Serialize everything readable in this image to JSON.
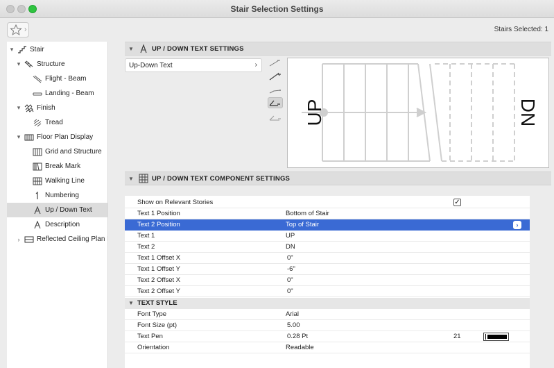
{
  "window": {
    "title": "Stair Selection Settings"
  },
  "toolbar": {
    "stairs_selected": "Stairs Selected: 1"
  },
  "tree": [
    {
      "label": "Stair",
      "icon": "stair-icon",
      "disclosure": "▾"
    },
    {
      "label": "Structure",
      "icon": "structure-icon",
      "disclosure": "▾"
    },
    {
      "label": "Flight - Beam",
      "icon": "flight-beam-icon",
      "disclosure": ""
    },
    {
      "label": "Landing - Beam",
      "icon": "landing-beam-icon",
      "disclosure": ""
    },
    {
      "label": "Finish",
      "icon": "finish-icon",
      "disclosure": "▾"
    },
    {
      "label": "Tread",
      "icon": "tread-icon",
      "disclosure": ""
    },
    {
      "label": "Floor Plan Display",
      "icon": "floor-plan-icon",
      "disclosure": "▾"
    },
    {
      "label": "Grid and Structure",
      "icon": "grid-icon",
      "disclosure": ""
    },
    {
      "label": "Break Mark",
      "icon": "break-mark-icon",
      "disclosure": ""
    },
    {
      "label": "Walking Line",
      "icon": "walking-line-icon",
      "disclosure": ""
    },
    {
      "label": "Numbering",
      "icon": "numbering-icon",
      "disclosure": ""
    },
    {
      "label": "Up / Down Text",
      "icon": "text-a-icon",
      "disclosure": ""
    },
    {
      "label": "Description",
      "icon": "text-a-icon",
      "disclosure": ""
    },
    {
      "label": "Reflected Ceiling Plan Display",
      "icon": "ceiling-plan-icon",
      "disclosure": "›"
    }
  ],
  "section1": {
    "title": "UP / DOWN TEXT SETTINGS",
    "dropdown": "Up-Down Text"
  },
  "preview": {
    "up_text": "UP",
    "down_text": "DN"
  },
  "section2": {
    "title": "UP / DOWN TEXT COMPONENT SETTINGS"
  },
  "props": [
    {
      "name": "Show on Relevant Stories",
      "value": "",
      "extra": "",
      "checkbox": "✓"
    },
    {
      "name": "Text 1 Position",
      "value": "Bottom of Stair",
      "extra": ""
    },
    {
      "name": "Text 2 Position",
      "value": "Top of Stair",
      "extra": ""
    },
    {
      "name": "Text 1",
      "value": "UP",
      "extra": ""
    },
    {
      "name": "Text 2",
      "value": "DN",
      "extra": ""
    },
    {
      "name": "Text 1 Offset X",
      "value": "0\"",
      "extra": ""
    },
    {
      "name": "Text 1 Offset Y",
      "value": "-6\"",
      "extra": ""
    },
    {
      "name": "Text 2 Offset X",
      "value": "0\"",
      "extra": ""
    },
    {
      "name": "Text 2 Offset Y",
      "value": "0\"",
      "extra": ""
    }
  ],
  "text_style": {
    "title": "TEXT STYLE",
    "rows": [
      {
        "name": "Font Type",
        "value": "Arial",
        "extra": ""
      },
      {
        "name": "Font Size (pt)",
        "value": "5.00",
        "extra": ""
      },
      {
        "name": "Text Pen",
        "value": "0.28 Pt",
        "extra": "21"
      },
      {
        "name": "Orientation",
        "value": "Readable",
        "extra": ""
      }
    ]
  },
  "colors": {
    "selection": "#3a6ad4",
    "maximize": "#2fc440"
  }
}
